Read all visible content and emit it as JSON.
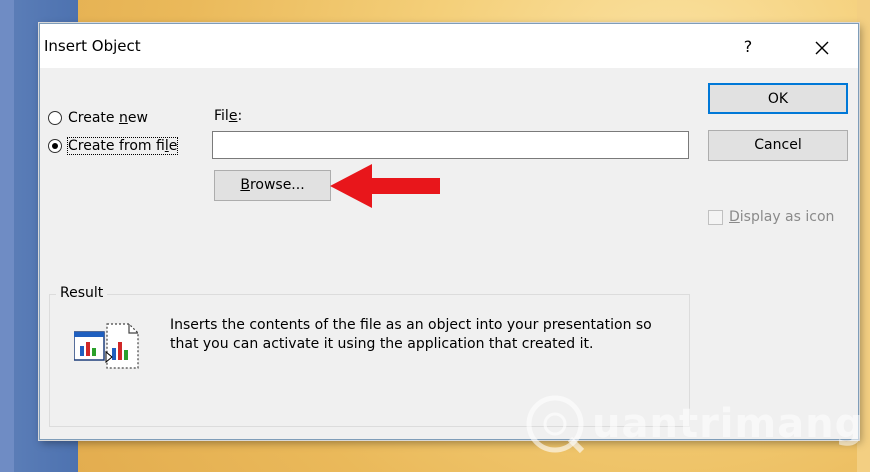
{
  "dialog": {
    "title": "Insert Object",
    "help_label": "?"
  },
  "options": {
    "create_new_pre": "Create ",
    "create_new_u": "n",
    "create_new_post": "ew",
    "create_from_file_pre": "Create from fi",
    "create_from_file_u": "l",
    "create_from_file_post": "e",
    "selected": "create_from_file"
  },
  "file": {
    "label_pre": "Fil",
    "label_u": "e",
    "label_post": ":",
    "value": "",
    "browse_u": "B",
    "browse_post": "rowse..."
  },
  "buttons": {
    "ok": "OK",
    "cancel": "Cancel"
  },
  "display_as_icon": {
    "pre": "",
    "u": "D",
    "post": "isplay as icon",
    "checked": false
  },
  "result": {
    "legend": "Result",
    "text": "Inserts the contents of the file as an object into your presentation so that you can activate it using the application that created it."
  },
  "watermark": {
    "text": "uantrimang"
  },
  "colors": {
    "arrow": "#e8161b",
    "focus_border": "#0078d7"
  }
}
